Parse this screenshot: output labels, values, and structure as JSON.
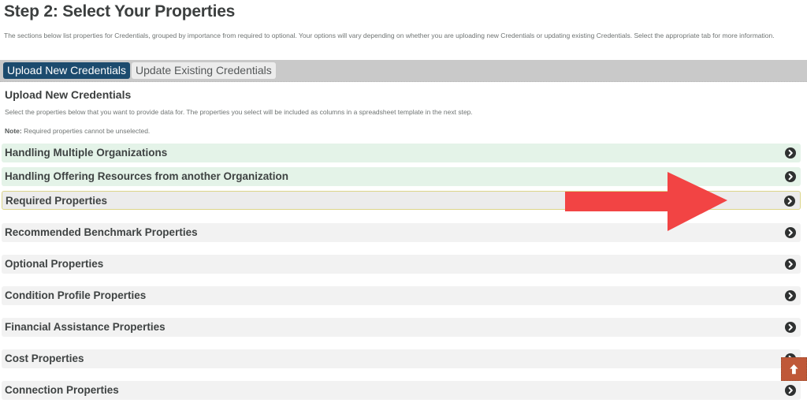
{
  "page": {
    "title": "Step 2: Select Your Properties",
    "intro": "The sections below list properties for Credentials, grouped by importance from required to optional. Your options will vary depending on whether you are uploading new Credentials or updating existing Credentials. Select the appropriate tab for more information."
  },
  "tabs": [
    {
      "label": "Upload New Credentials",
      "active": true
    },
    {
      "label": "Update Existing Credentials",
      "active": false
    }
  ],
  "section": {
    "title": "Upload New Credentials",
    "description": "Select the properties below that you want to provide data for. The properties you select will be included as columns in a spreadsheet template in the next step.",
    "note_label": "Note:",
    "note_text": " Required properties cannot be unselected."
  },
  "accordions": [
    {
      "label": "Handling Multiple Organizations",
      "style": "green",
      "icon": "chevron-right-circle-icon"
    },
    {
      "label": "Handling Offering Resources from another Organization",
      "style": "green",
      "icon": "chevron-right-circle-icon"
    },
    {
      "label": "Required Properties",
      "style": "selected",
      "icon": "chevron-right-circle-icon"
    },
    {
      "label": "Recommended Benchmark Properties",
      "style": "gray",
      "icon": "chevron-right-circle-icon"
    },
    {
      "label": "Optional Properties",
      "style": "gray",
      "icon": "chevron-right-circle-icon"
    },
    {
      "label": "Condition Profile Properties",
      "style": "gray",
      "icon": "chevron-right-circle-icon"
    },
    {
      "label": "Financial Assistance Properties",
      "style": "gray",
      "icon": "chevron-right-circle-icon"
    },
    {
      "label": "Cost Properties",
      "style": "gray",
      "icon": "chevron-right-circle-icon"
    },
    {
      "label": "Connection Properties",
      "style": "gray",
      "icon": "chevron-right-circle-icon"
    }
  ],
  "annotation": {
    "icon": "red-arrow-icon",
    "color": "#f24444"
  },
  "scroll_top": {
    "icon": "arrow-up-icon",
    "color": "#bf5838"
  },
  "colors": {
    "tab_active": "#1c4b6e",
    "tab_bar": "#c9c9c9",
    "accordion_green": "#e4f3e8",
    "accordion_gray": "#f2f2f2",
    "selected_border": "#dcd58a"
  }
}
